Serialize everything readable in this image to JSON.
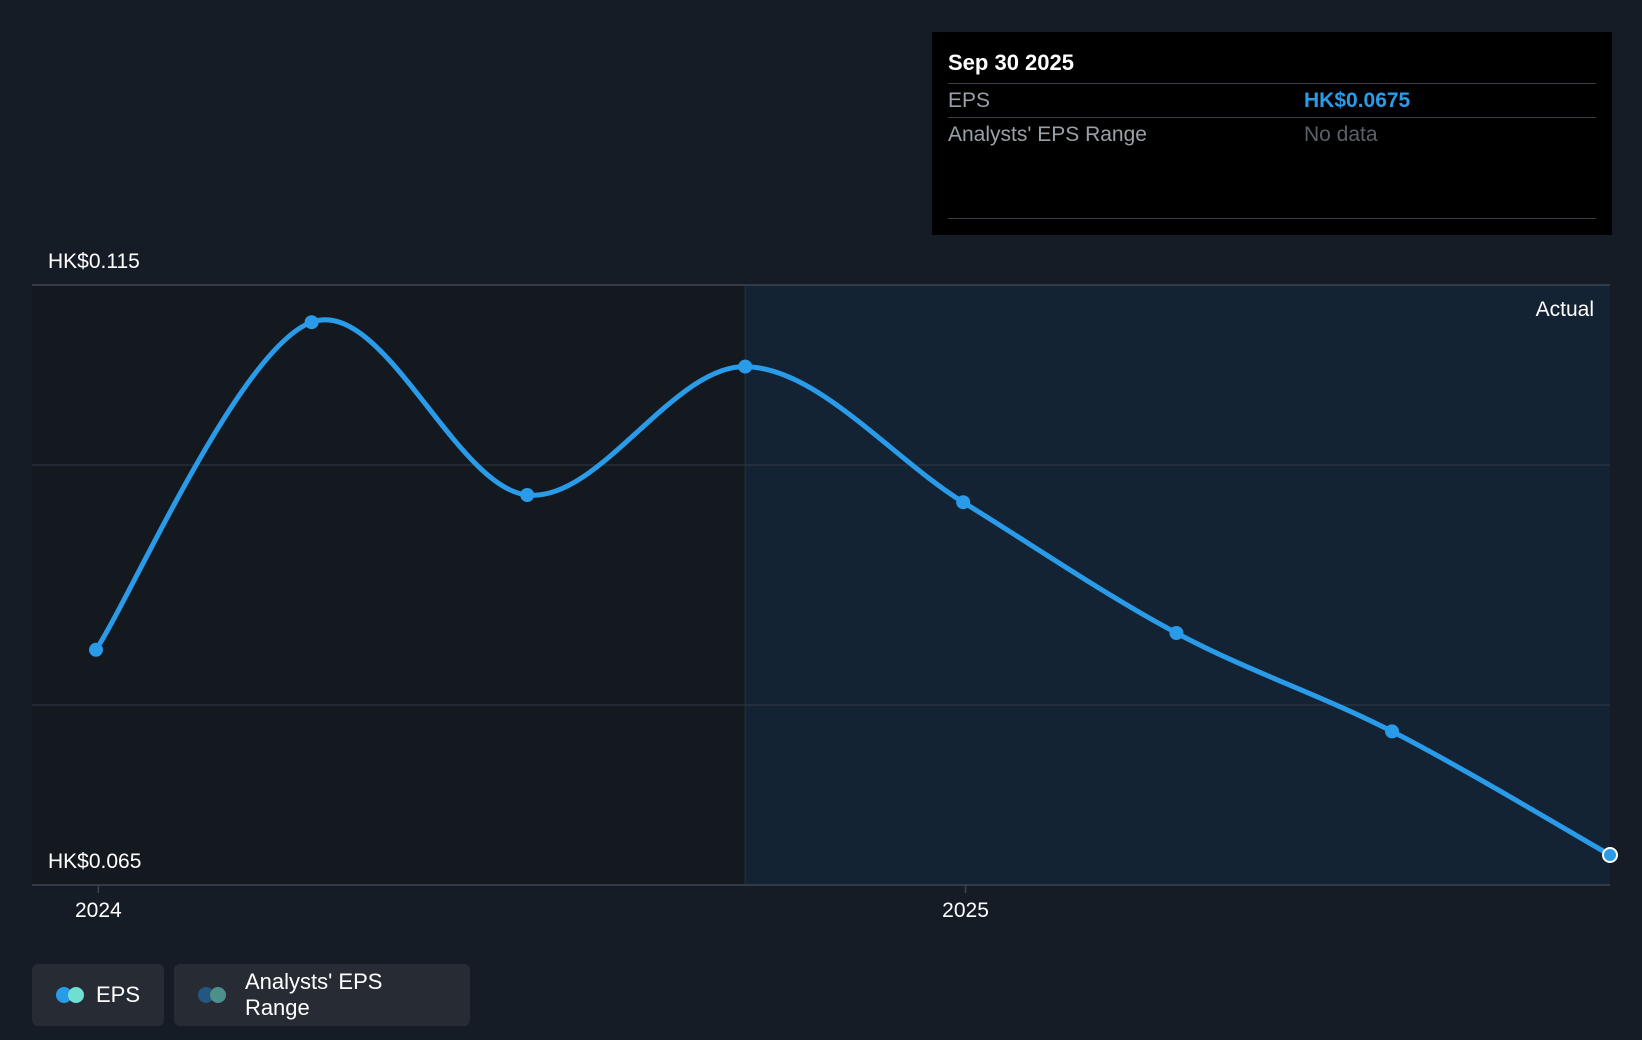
{
  "colors": {
    "background": "#161c26",
    "past_region": "#141920",
    "future_region": "#132334",
    "eps_line": "#2a9be8",
    "grid": "#313843",
    "range_legend_dark": "#235680",
    "range_legend_light": "#4d8f8a",
    "eps_legend_dark": "#2a9be8",
    "eps_legend_light": "#6fe0d0"
  },
  "tooltip": {
    "date": "Sep 30 2025",
    "eps_label": "EPS",
    "eps_value": "HK$0.0675",
    "range_label": "Analysts' EPS Range",
    "range_value": "No data"
  },
  "legend": {
    "eps_label": "EPS",
    "range_label": "Analysts' EPS Range"
  },
  "chart_data": {
    "type": "line",
    "y_top_label": "HK$0.115",
    "y_bottom_label": "HK$0.065",
    "ylim": [
      0.065,
      0.115
    ],
    "region_label": "Actual",
    "x_ticks": [
      {
        "label": "2024",
        "value": "2024-01-01"
      },
      {
        "label": "2025",
        "value": "2025-01-01"
      }
    ],
    "xlim": [
      "2023-12-31",
      "2025-09-30"
    ],
    "region_start": "2024-09-30",
    "grid_y": [
      0.1,
      0.08
    ],
    "series": [
      {
        "name": "EPS",
        "points": [
          {
            "x": "2023-12-31",
            "y": 0.0846
          },
          {
            "x": "2024-03-31",
            "y": 0.1119
          },
          {
            "x": "2024-06-30",
            "y": 0.0975
          },
          {
            "x": "2024-09-30",
            "y": 0.1082
          },
          {
            "x": "2024-12-31",
            "y": 0.0969
          },
          {
            "x": "2025-03-31",
            "y": 0.086
          },
          {
            "x": "2025-06-30",
            "y": 0.0778
          },
          {
            "x": "2025-09-30",
            "y": 0.0675
          }
        ]
      }
    ]
  }
}
